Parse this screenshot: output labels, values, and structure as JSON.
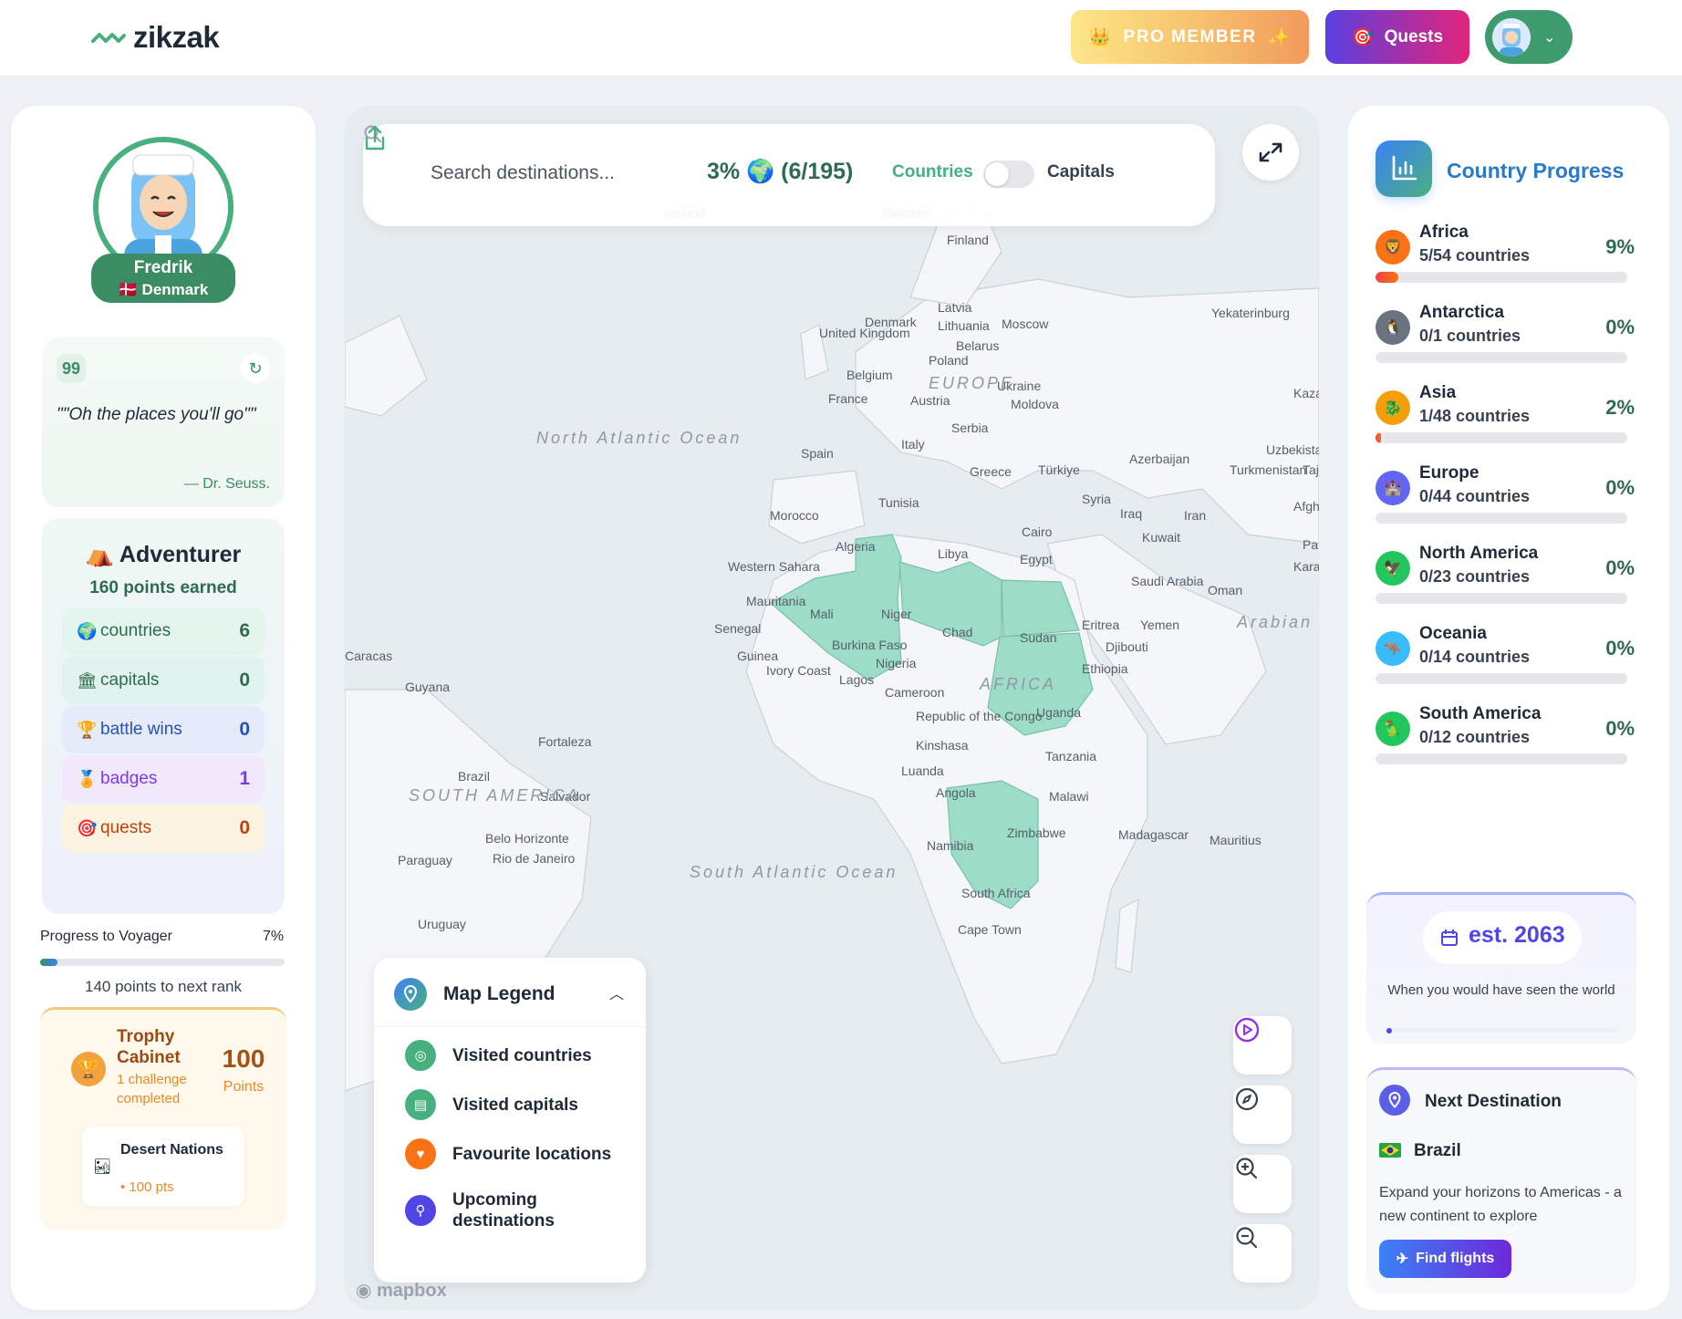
{
  "header": {
    "logo_text": "zikzak",
    "pro_label": "PRO MEMBER",
    "quests_label": "Quests"
  },
  "profile": {
    "name": "Fredrik",
    "country": "🇩🇰 Denmark"
  },
  "quote": {
    "mark": "99",
    "text": "\"\"Oh the places you'll go\"\"",
    "author": "— Dr. Seuss."
  },
  "rank": {
    "icon": "⛺",
    "title": "Adventurer",
    "points": "160 points earned",
    "stats": [
      {
        "icon": "🌍",
        "label": "countries",
        "value": "6",
        "bg": "#e3f5ec",
        "fg": "#2f6b4f"
      },
      {
        "icon": "🏛",
        "label": "capitals",
        "value": "0",
        "bg": "#e0f3ee",
        "fg": "#2f6b4f"
      },
      {
        "icon": "🏆",
        "label": "battle wins",
        "value": "0",
        "bg": "#e5ebfb",
        "fg": "#2453b5"
      },
      {
        "icon": "🏅",
        "label": "badges",
        "value": "1",
        "bg": "#f1e8fb",
        "fg": "#7c3aed"
      },
      {
        "icon": "🎯",
        "label": "quests",
        "value": "0",
        "bg": "#fdf3e1",
        "fg": "#c2410c"
      }
    ]
  },
  "progress": {
    "label": "Progress to Voyager",
    "pct_text": "7%",
    "pct": 0.07,
    "next": "140 points to next rank"
  },
  "trophy": {
    "title": "Trophy Cabinet",
    "subtitle": "1 challenge completed",
    "points_value": "100",
    "points_label": "Points",
    "item_name": "Desert Nations",
    "item_points": "• 100 pts"
  },
  "map": {
    "search_placeholder": "Search destinations...",
    "visited_pct": "3% 🌍 (6/195)",
    "toggle_countries": "Countries",
    "toggle_capitals": "Capitals",
    "attribution": "mapbox",
    "labels": [
      "Iceland",
      "Sweden",
      "Finland",
      "Denmark",
      "Moscow",
      "Yekaterinburg",
      "United Kingdom",
      "Belarus",
      "Lithuania",
      "Latvia",
      "Poland",
      "Ukraine",
      "Belgium",
      "France",
      "Austria",
      "Moldova",
      "Kazakhstan",
      "Serbia",
      "Italy",
      "Spain",
      "Greece",
      "Türkiye",
      "Uzbekistan",
      "Turkmenistan",
      "Azerbaijan",
      "Tajik",
      "Tunisia",
      "Morocco",
      "Syria",
      "Iraq",
      "Iran",
      "Afghanistan",
      "Kuwait",
      "Algeria",
      "Libya",
      "Cairo",
      "Egypt",
      "Pakistan",
      "Karachi",
      "Western Sahara",
      "Saudi Arabia",
      "Oman",
      "Mauritania",
      "Mali",
      "Niger",
      "Chad",
      "Sudan",
      "Eritrea",
      "Yemen",
      "Senegal",
      "Burkina Faso",
      "Guinea",
      "Ivory Coast",
      "Nigeria",
      "Djibouti",
      "Ethiopia",
      "Lagos",
      "Cameroon",
      "Caracas",
      "Guyana",
      "Republic of the Congo",
      "Kinshasa",
      "Uganda",
      "Tanzania",
      "Fortaleza",
      "Brazil",
      "Salvador",
      "Luanda",
      "Angola",
      "Malawi",
      "Belo Horizonte",
      "Rio de Janeiro",
      "Paraguay",
      "Zimbabwe",
      "Madagascar",
      "Mauritius",
      "Namibia",
      "South Africa",
      "Cape Town",
      "Uruguay",
      "North Atlantic Ocean",
      "South Atlantic Ocean",
      "Arabian Sea",
      "SOUTH AMERICA",
      "EUROPE",
      "AFRICA"
    ]
  },
  "legend": {
    "title": "Map Legend",
    "items": [
      {
        "label": "Visited countries",
        "color": "#48b07f",
        "icon": "◎"
      },
      {
        "label": "Visited capitals",
        "color": "#48b07f",
        "icon": "▤"
      },
      {
        "label": "Favourite locations",
        "color": "#f97316",
        "icon": "♥"
      },
      {
        "label": "Upcoming destinations",
        "color": "#4f46e5",
        "icon": "⚲"
      }
    ]
  },
  "country_progress": {
    "title": "Country Progress",
    "continents": [
      {
        "name": "Africa",
        "sub": "5/54 countries",
        "pct": "9%",
        "value": 0.09,
        "icon": "🦁",
        "bg": "#f97316"
      },
      {
        "name": "Antarctica",
        "sub": "0/1 countries",
        "pct": "0%",
        "value": 0,
        "icon": "🐧",
        "bg": "#6b7280"
      },
      {
        "name": "Asia",
        "sub": "1/48 countries",
        "pct": "2%",
        "value": 0.02,
        "icon": "🐉",
        "bg": "#f59e0b"
      },
      {
        "name": "Europe",
        "sub": "0/44 countries",
        "pct": "0%",
        "value": 0,
        "icon": "🏰",
        "bg": "#6366f1"
      },
      {
        "name": "North America",
        "sub": "0/23 countries",
        "pct": "0%",
        "value": 0,
        "icon": "🦅",
        "bg": "#22c55e"
      },
      {
        "name": "Oceania",
        "sub": "0/14 countries",
        "pct": "0%",
        "value": 0,
        "icon": "🦘",
        "bg": "#38bdf8"
      },
      {
        "name": "South America",
        "sub": "0/12 countries",
        "pct": "0%",
        "value": 0,
        "icon": "🦜",
        "bg": "#22c55e"
      }
    ]
  },
  "estimate": {
    "value": "est. 2063",
    "caption": "When you would have seen the world"
  },
  "next_destination": {
    "title": "Next Destination",
    "country": "Brazil",
    "description": "Expand your horizons to Americas - a new continent to explore",
    "button": "Find flights"
  },
  "colors": {
    "brand_green": "#3a8d63",
    "visited_fill": "#9ddcc6",
    "accent_blue": "#2b79c9"
  }
}
